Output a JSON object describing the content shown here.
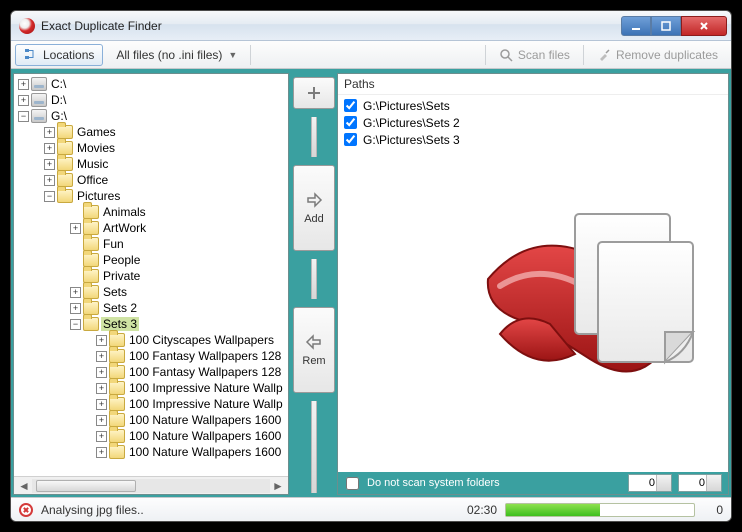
{
  "app_title": "Exact Duplicate Finder",
  "toolbar": {
    "locations": "Locations",
    "filefilter": "All files (no .ini files)",
    "scan": "Scan files",
    "remove": "Remove duplicates"
  },
  "tree": {
    "drives": [
      {
        "label": "C:\\",
        "expanded": false
      },
      {
        "label": "D:\\",
        "expanded": false
      }
    ],
    "gdrive": {
      "label": "G:\\"
    },
    "gchildren": [
      {
        "label": "Games"
      },
      {
        "label": "Movies"
      },
      {
        "label": "Music"
      },
      {
        "label": "Office"
      }
    ],
    "pictures": {
      "label": "Pictures"
    },
    "picchildren": [
      {
        "label": "Animals"
      },
      {
        "label": "ArtWork"
      },
      {
        "label": "Fun"
      },
      {
        "label": "People"
      },
      {
        "label": "Private"
      },
      {
        "label": "Sets"
      },
      {
        "label": "Sets 2"
      }
    ],
    "sets3": {
      "label": "Sets 3"
    },
    "sets3children": [
      {
        "label": "100 Cityscapes Wallpapers"
      },
      {
        "label": "100 Fantasy Wallpapers 128"
      },
      {
        "label": "100 Fantasy Wallpapers 128"
      },
      {
        "label": "100 Impressive Nature Wallp"
      },
      {
        "label": "100 Impressive Nature Wallp"
      },
      {
        "label": "100 Nature Wallpapers 1600"
      },
      {
        "label": "100 Nature Wallpapers 1600"
      },
      {
        "label": "100 Nature Wallpapers 1600"
      }
    ]
  },
  "mid": {
    "add": "Add",
    "rem": "Rem"
  },
  "paths": {
    "header": "Paths",
    "items": [
      {
        "checked": true,
        "text": "G:\\Pictures\\Sets"
      },
      {
        "checked": true,
        "text": "G:\\Pictures\\Sets 2"
      },
      {
        "checked": true,
        "text": "G:\\Pictures\\Sets 3"
      }
    ]
  },
  "bottom": {
    "noscan": "Do not scan system folders",
    "spin1": "0",
    "spin2": "0"
  },
  "status": {
    "msg": "Analysing jpg files..",
    "clock": "02:30",
    "count": "0"
  }
}
